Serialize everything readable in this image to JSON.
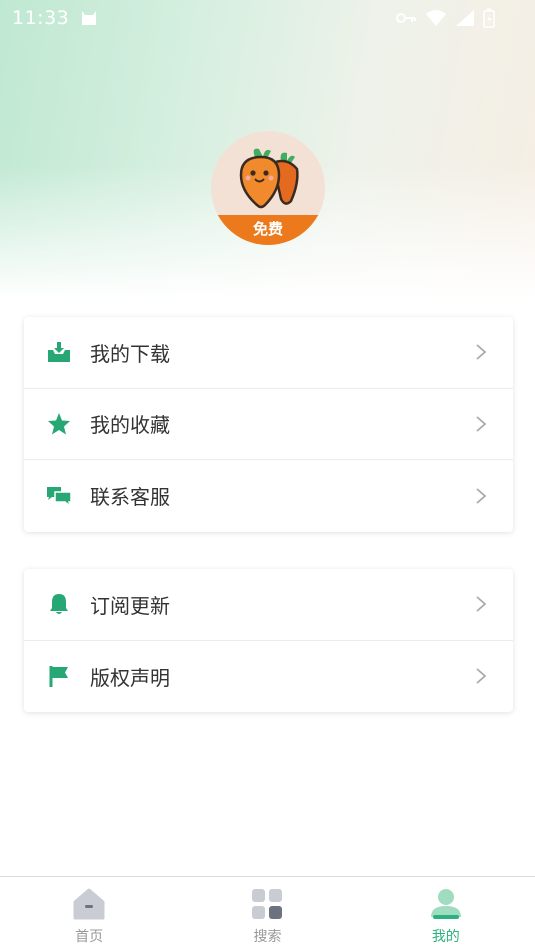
{
  "status_bar": {
    "time": "11:33"
  },
  "avatar": {
    "badge": "免费"
  },
  "menu_group_1": [
    {
      "label": "我的下载",
      "icon": "download-tray-icon"
    },
    {
      "label": "我的收藏",
      "icon": "star-icon"
    },
    {
      "label": "联系客服",
      "icon": "chat-bubbles-icon"
    }
  ],
  "menu_group_2": [
    {
      "label": "订阅更新",
      "icon": "bell-icon"
    },
    {
      "label": "版权声明",
      "icon": "flag-icon"
    }
  ],
  "tabbar": {
    "items": [
      {
        "label": "首页",
        "icon": "home-icon",
        "active": false
      },
      {
        "label": "搜索",
        "icon": "grid-icon",
        "active": false
      },
      {
        "label": "我的",
        "icon": "user-icon",
        "active": true
      }
    ]
  },
  "colors": {
    "accent": "#2bb07f",
    "icon_green": "#27a774",
    "badge_orange": "#ec7a1c"
  }
}
